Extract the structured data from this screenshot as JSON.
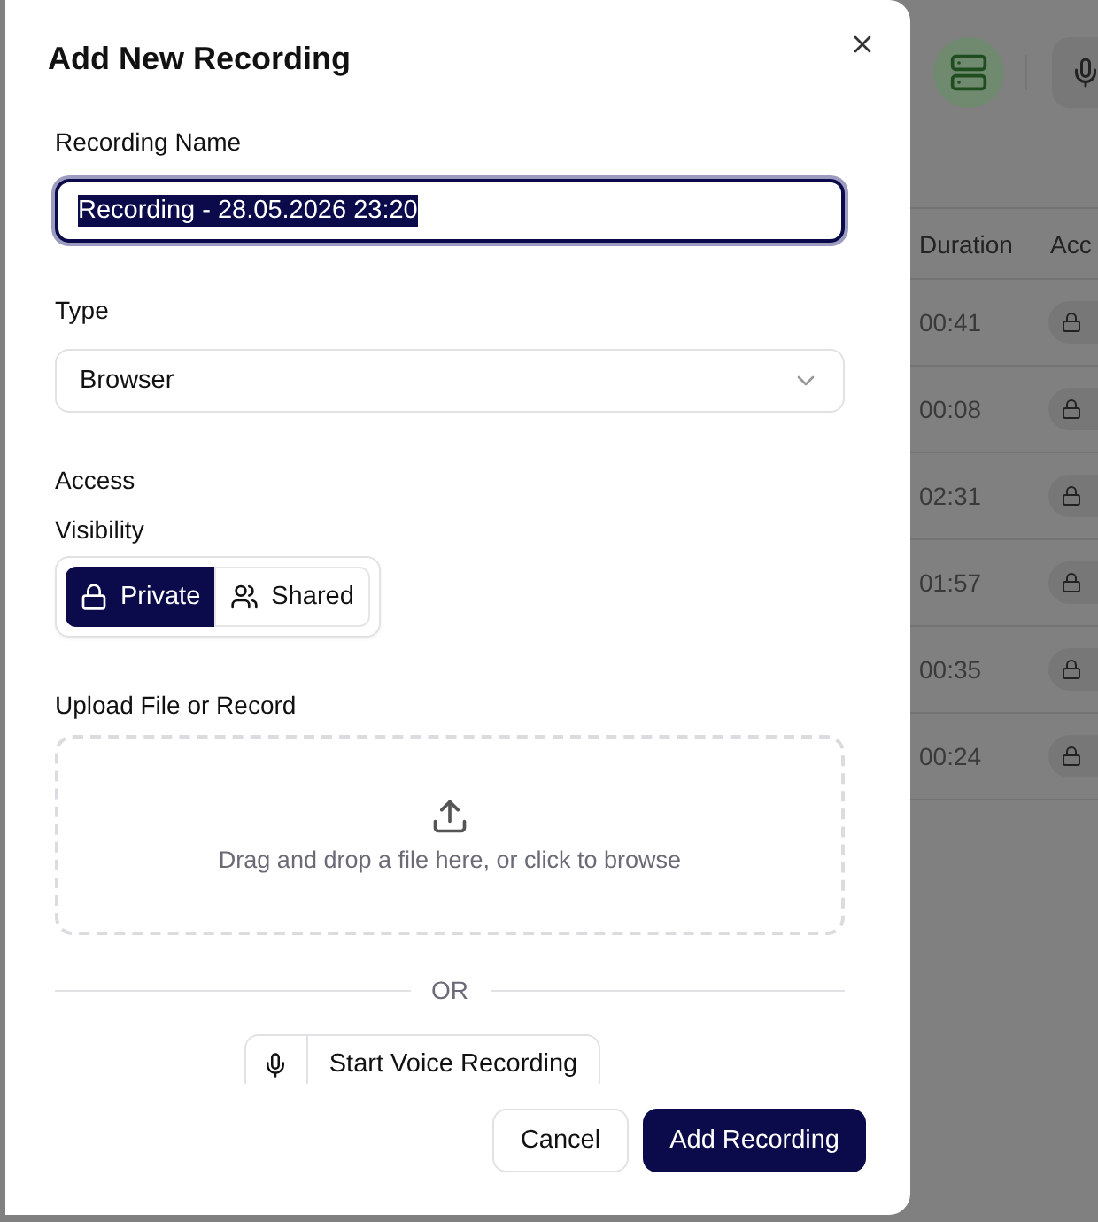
{
  "background": {
    "table": {
      "columns": [
        "Duration",
        "Acc"
      ],
      "rows": [
        {
          "duration": "00:41"
        },
        {
          "duration": "00:08"
        },
        {
          "duration": "02:31"
        },
        {
          "duration": "01:57"
        },
        {
          "duration": "00:35"
        },
        {
          "duration": "00:24"
        }
      ]
    }
  },
  "dialog": {
    "title": "Add New Recording",
    "name_field": {
      "label": "Recording Name",
      "value": "Recording - 28.05.2026 23:20"
    },
    "type_field": {
      "label": "Type",
      "value": "Browser"
    },
    "access": {
      "heading": "Access",
      "label": "Visibility",
      "options": [
        {
          "kind": "private",
          "label": "Private",
          "selected": true
        },
        {
          "kind": "shared",
          "label": "Shared",
          "selected": false
        }
      ]
    },
    "upload": {
      "label": "Upload File or Record",
      "hint": "Drag and drop a file here, or click to browse"
    },
    "divider": "OR",
    "voice_button": "Start Voice Recording",
    "buttons": [
      {
        "kind": "secondary",
        "label": "Cancel"
      },
      {
        "kind": "primary",
        "label": "Add Recording"
      }
    ]
  }
}
